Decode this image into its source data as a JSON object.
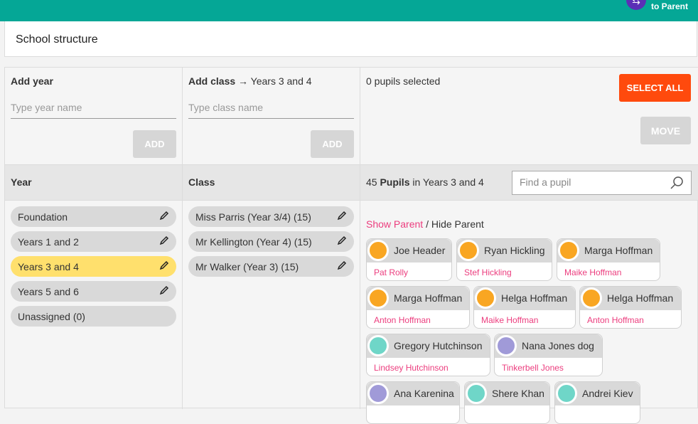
{
  "topbar": {
    "switch_label": "to Parent"
  },
  "page": {
    "title": "School structure"
  },
  "year_form": {
    "title": "Add year",
    "placeholder": "Type year name",
    "add_label": "ADD"
  },
  "class_form": {
    "title": "Add class",
    "arrow": "→",
    "context": "Years 3 and 4",
    "placeholder": "Type class name",
    "add_label": "ADD"
  },
  "selection": {
    "status": "0 pupils selected",
    "select_all_label": "SELECT ALL",
    "move_label": "MOVE"
  },
  "year_column": {
    "header": "Year",
    "items": [
      {
        "label": "Foundation",
        "editable": true
      },
      {
        "label": "Years 1 and 2",
        "editable": true
      },
      {
        "label": "Years 3 and 4",
        "editable": true,
        "active": true
      },
      {
        "label": "Years 5 and 6",
        "editable": true
      },
      {
        "label": "Unassigned (0)",
        "editable": false
      }
    ]
  },
  "class_column": {
    "header": "Class",
    "items": [
      {
        "label": "Miss Parris (Year 3/4) (15)"
      },
      {
        "label": "Mr Kellington (Year 4) (15)"
      },
      {
        "label": "Mr Walker (Year 3) (15)"
      }
    ]
  },
  "pupils": {
    "count": "45",
    "count_word": "Pupils",
    "count_suffix": "in Years 3 and 4",
    "search_placeholder": "Find a pupil",
    "show_parent": "Show Parent",
    "separator": "/",
    "hide_parent": "Hide Parent",
    "cards": [
      {
        "name": "Joe Header",
        "parent": "Pat Rolly",
        "avatar": "orange"
      },
      {
        "name": "Ryan Hickling",
        "parent": "Stef Hickling",
        "avatar": "orange"
      },
      {
        "name": "Marga Hoffman",
        "parent": "Maike Hoffman",
        "avatar": "orange"
      },
      {
        "name": "Marga Hoffman",
        "parent": "Anton Hoffman",
        "avatar": "orange"
      },
      {
        "name": "Helga Hoffman",
        "parent": "Maike Hoffman",
        "avatar": "orange"
      },
      {
        "name": "Helga Hoffman",
        "parent": "Anton Hoffman",
        "avatar": "orange"
      },
      {
        "name": "Gregory Hutchinson",
        "parent": "Lindsey Hutchinson",
        "avatar": "teal"
      },
      {
        "name": "Nana Jones dog",
        "parent": "Tinkerbell Jones",
        "avatar": "purple"
      },
      {
        "name": "Ana Karenina",
        "parent": "",
        "avatar": "purple"
      },
      {
        "name": "Shere Khan",
        "parent": "",
        "avatar": "teal"
      },
      {
        "name": "Andrei Kiev",
        "parent": "",
        "avatar": "teal"
      }
    ]
  }
}
